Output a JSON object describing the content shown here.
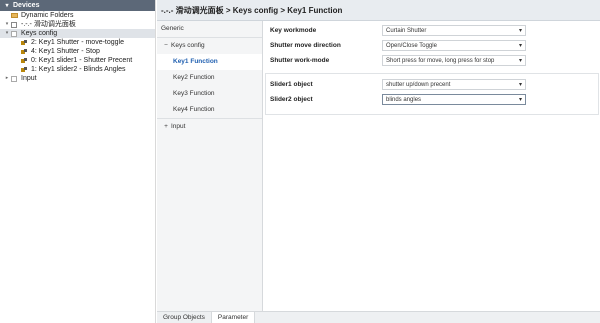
{
  "devices": {
    "header": "Devices",
    "tree": [
      {
        "label": "Dynamic Folders",
        "icon": "folder-icon",
        "expander": "",
        "indent": 1
      },
      {
        "label": "-.-.- 滑动调光面板",
        "icon": "device-icon",
        "expander": "▾",
        "indent": 1
      },
      {
        "label": "Keys config",
        "icon": "square-icon",
        "expander": "▾",
        "indent": 1
      },
      {
        "label": "2: Key1 Shutter - move-toggle",
        "icon": "object-icon",
        "expander": "",
        "indent": 2
      },
      {
        "label": "4: Key1 Shutter - Stop",
        "icon": "object-icon",
        "expander": "",
        "indent": 2
      },
      {
        "label": "0: Key1 slider1 - Shutter Precent",
        "icon": "object-icon",
        "expander": "",
        "indent": 2
      },
      {
        "label": "1: Key1 slider2 - Blinds Angles",
        "icon": "object-icon",
        "expander": "",
        "indent": 2
      },
      {
        "label": "Input",
        "icon": "square-icon",
        "expander": "▸",
        "indent": 1
      }
    ]
  },
  "breadcrumb": "-.-.- 滑动调光面板 > Keys config > Key1 Function",
  "nav": {
    "generic": "Generic",
    "keys_config_symbol": "−",
    "keys_config": "Keys config",
    "key1": "Key1 Function",
    "key2": "Key2 Function",
    "key3": "Key3 Function",
    "key4": "Key4 Function",
    "input_symbol": "+",
    "input": "Input"
  },
  "params": {
    "key_workmode": {
      "label": "Key workmode",
      "value": "Curtain Shutter"
    },
    "shutter_move_direction": {
      "label": "Shutter move direction",
      "value": "Open/Close Toggle"
    },
    "shutter_work_mode": {
      "label": "Shutter work-mode",
      "value": "Short press for move, long press for stop"
    },
    "slider1": {
      "label": "Slider1 object",
      "value": "shutter up/down precent"
    },
    "slider2": {
      "label": "Slider2 object",
      "value": "blinds angles"
    }
  },
  "dropdown_arrow": "▾",
  "tabs": {
    "group_objects": "Group Objects",
    "parameter": "Parameter"
  },
  "colors": {
    "header_bg": "#5c6878",
    "active_nav": "#1f5fb0",
    "selected_row": "#dfe3e8"
  }
}
